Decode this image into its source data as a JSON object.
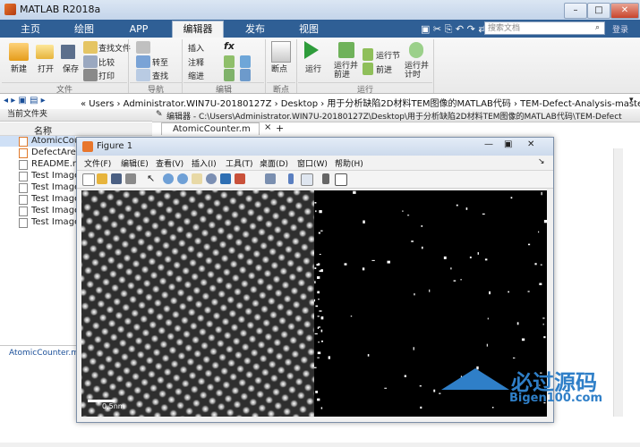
{
  "window": {
    "title": "MATLAB R2018a"
  },
  "tabs": [
    {
      "label": "主页"
    },
    {
      "label": "绘图"
    },
    {
      "label": "APP"
    },
    {
      "label": "编辑器"
    },
    {
      "label": "发布"
    },
    {
      "label": "视图"
    }
  ],
  "search": {
    "placeholder": "搜索文档",
    "user": "登录"
  },
  "ribbon": {
    "file": {
      "new": "新建",
      "open": "打开",
      "save": "保存",
      "find_files": "查找文件",
      "compare": "比较",
      "print": "打印",
      "group": "文件"
    },
    "nav": {
      "goto": "转至",
      "find": "查找",
      "group": "导航"
    },
    "edit": {
      "insert": "插入",
      "comment": "注释",
      "indent": "缩进",
      "fx": "fx",
      "group": "编辑"
    },
    "breakpoints": {
      "label": "断点",
      "group": "断点"
    },
    "run": {
      "run": "运行",
      "run_advance": "运行并\n前进",
      "run_section": "运行节",
      "advance": "前进",
      "run_time": "运行并\n计时",
      "group": "运行"
    }
  },
  "address": {
    "path": "« Users › Administrator.WIN7U-20180127Z › Desktop › 用于分析缺陷2D材料TEM图像的MATLAB代码 › TEM-Defect-Analysis-master"
  },
  "left_panel": {
    "header": "当前文件夹",
    "column": "名称",
    "files": [
      "AtomicCoun",
      "DefectAreaM",
      "README.md",
      "Test Image",
      "Test Image",
      "Test Image",
      "Test Image",
      "Test Image"
    ],
    "details": "AtomicCounter.m"
  },
  "editor": {
    "title": "编辑器 - C:\\Users\\Administrator.WIN7U-20180127Z\\Desktop\\用于分析缺陷2D材料TEM图像的MATLAB代码\\TEM-Defect",
    "tab": "AtomicCounter.m"
  },
  "figure": {
    "title": "Figure 1",
    "menu": [
      "文件(F)",
      "编辑(E)",
      "查看(V)",
      "插入(I)",
      "工具(T)",
      "桌面(D)",
      "窗口(W)",
      "帮助(H)"
    ],
    "scale_label": "0.5nm"
  },
  "watermark": {
    "title": "必过源码",
    "url": "Bigen100.com"
  },
  "colors": {
    "tab_bar": "#2f5f95",
    "accent": "#e8762c"
  }
}
